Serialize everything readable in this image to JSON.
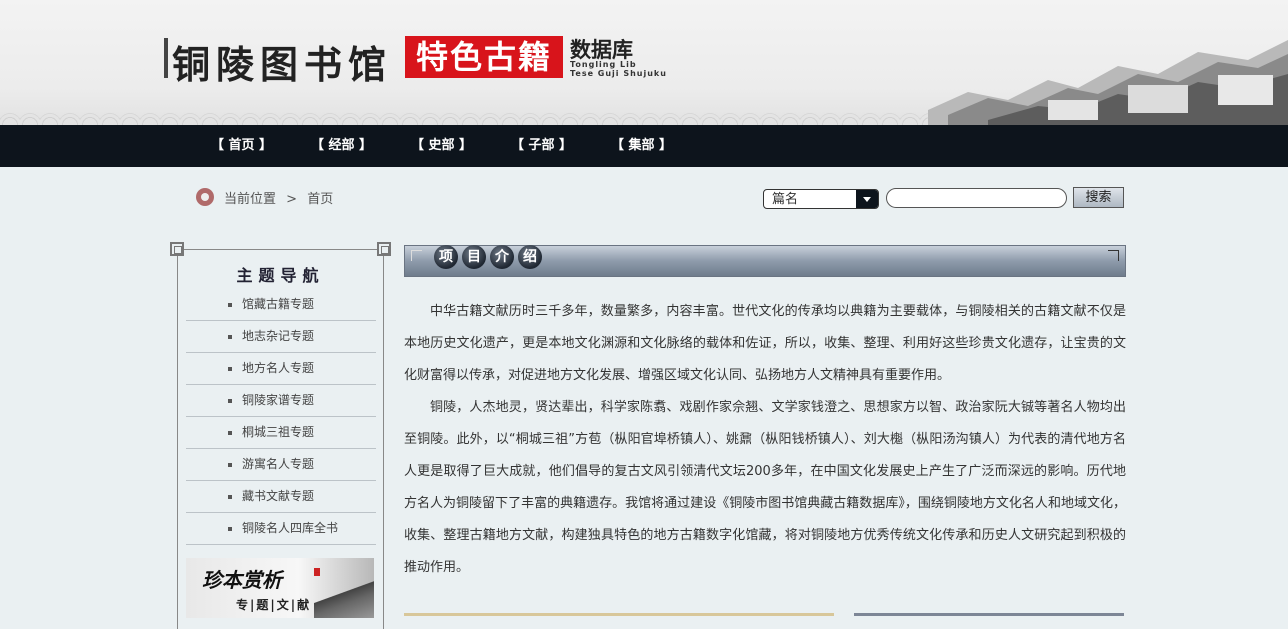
{
  "header": {
    "logo_cn": "铜陵图书馆",
    "logo_red": "特色古籍",
    "logo_db": "数据库",
    "logo_en_1": "Tongling Lib",
    "logo_en_2": "Tese Guji Shujuku"
  },
  "nav": {
    "items": [
      "【 首页 】",
      "【 经部 】",
      "【 史部 】",
      "【 子部 】",
      "【 集部 】"
    ]
  },
  "breadcrumb": {
    "label": "当前位置",
    "separator": ">",
    "current": "首页"
  },
  "search": {
    "field_selected": "篇名",
    "input_value": "",
    "button_label": "搜索"
  },
  "sidebar": {
    "title": "主题导航",
    "items": [
      "馆藏古籍专题",
      "地志杂记专题",
      "地方名人专题",
      "铜陵家谱专题",
      "桐城三祖专题",
      "游寓名人专题",
      "藏书文献专题",
      "铜陵名人四库全书"
    ],
    "banner_title": "珍本赏析",
    "banner_sub": "专|题|文|献"
  },
  "section": {
    "title_chars": [
      "项",
      "目",
      "介",
      "绍"
    ]
  },
  "content": {
    "paragraphs": [
      "中华古籍文献历时三千多年，数量繁多，内容丰富。世代文化的传承均以典籍为主要载体，与铜陵相关的古籍文献不仅是本地历史文化遗产，更是本地文化渊源和文化脉络的载体和佐证，所以，收集、整理、利用好这些珍贵文化遗存，让宝贵的文化财富得以传承，对促进地方文化发展、增强区域文化认同、弘扬地方人文精神具有重要作用。",
      "铜陵，人杰地灵，贤达辈出，科学家陈翥、戏剧作家佘翘、文学家钱澄之、思想家方以智、政治家阮大铖等著名人物均出至铜陵。此外，以“桐城三祖”方苞（枞阳官埠桥镇人）、姚鼐（枞阳钱桥镇人）、刘大櫆（枞阳汤沟镇人）为代表的清代地方名人更是取得了巨大成就，他们倡导的复古文风引领清代文坛200多年，在中国文化发展史上产生了广泛而深远的影响。历代地方名人为铜陵留下了丰富的典籍遗存。我馆将通过建设《铜陵市图书馆典藏古籍数据库》，围绕铜陵地方文化名人和地域文化，收集、整理古籍地方文献，构建独具特色的地方古籍数字化馆藏，将对铜陵地方优秀传统文化传承和历史人文研究起到积极的推动作用。"
    ]
  }
}
